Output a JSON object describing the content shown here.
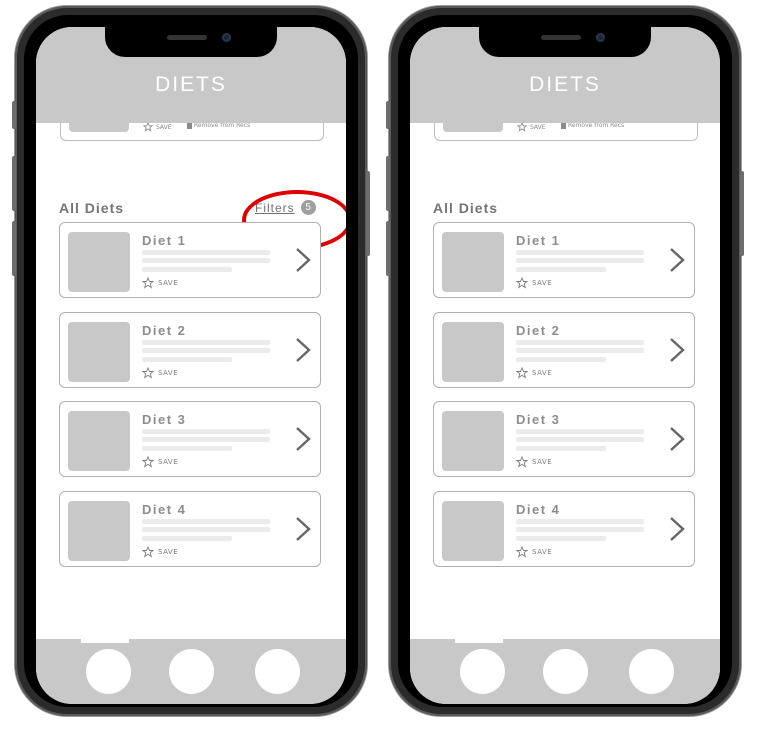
{
  "screens": [
    {
      "header": {
        "title": "DIETS"
      },
      "prev_card": {
        "save_label": "SAVE",
        "remove_label": "Remove from Recs"
      },
      "section": {
        "title": "All Diets"
      },
      "filters": {
        "label": "Filters",
        "count": "5",
        "highlighted": true
      },
      "cards": [
        {
          "title": "Diet 1",
          "save_label": "SAVE"
        },
        {
          "title": "Diet 2",
          "save_label": "SAVE"
        },
        {
          "title": "Diet 3",
          "save_label": "SAVE"
        },
        {
          "title": "Diet 4",
          "save_label": "SAVE"
        }
      ],
      "bottom_nav": {
        "buttons": 3
      }
    },
    {
      "header": {
        "title": "DIETS"
      },
      "prev_card": {
        "save_label": "SAVE",
        "remove_label": "Remove from Recs"
      },
      "section": {
        "title": "All Diets"
      },
      "cards": [
        {
          "title": "Diet 1",
          "save_label": "SAVE"
        },
        {
          "title": "Diet 2",
          "save_label": "SAVE"
        },
        {
          "title": "Diet 3",
          "save_label": "SAVE"
        },
        {
          "title": "Diet 4",
          "save_label": "SAVE"
        }
      ],
      "bottom_nav": {
        "buttons": 3
      }
    }
  ],
  "colors": {
    "header_bg": "#c8c8c8",
    "highlight": "#e00000",
    "card_border": "#b0b0b0",
    "text_gray": "#8d8d8d"
  },
  "icons": [
    "star-icon",
    "chevron-right-icon",
    "trash-icon"
  ]
}
